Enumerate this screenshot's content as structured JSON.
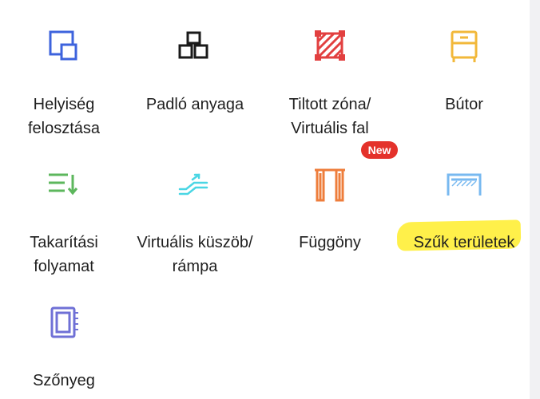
{
  "menu": {
    "items": [
      {
        "label": "Helyiség\nfelosztása",
        "icon": "room-split-icon"
      },
      {
        "label": "Padló anyaga",
        "icon": "floor-material-icon"
      },
      {
        "label": "Tiltott zóna/\nVirtuális fal",
        "icon": "no-go-zone-icon"
      },
      {
        "label": "Bútor",
        "icon": "furniture-icon"
      },
      {
        "label": "Takarítási\nfolyamat",
        "icon": "cleaning-sequence-icon"
      },
      {
        "label": "Virtuális küszöb/\nrámpa",
        "icon": "threshold-ramp-icon"
      },
      {
        "label": "Függöny",
        "icon": "curtain-icon"
      },
      {
        "label": "Szűk területek",
        "icon": "narrow-area-icon"
      },
      {
        "label": "Szőnyeg",
        "icon": "carpet-icon"
      }
    ],
    "new_badge": "New"
  },
  "colors": {
    "blue": "#3d63dd",
    "black": "#1a1a1a",
    "red": "#e24040",
    "yellow": "#f2b83a",
    "green": "#5db75d",
    "cyan": "#4ad6e4",
    "orange": "#ee7d3b",
    "light_blue": "#78b9f0",
    "purple": "#6f70d6",
    "badge": "#e4322b",
    "highlight": "#fff04a"
  }
}
